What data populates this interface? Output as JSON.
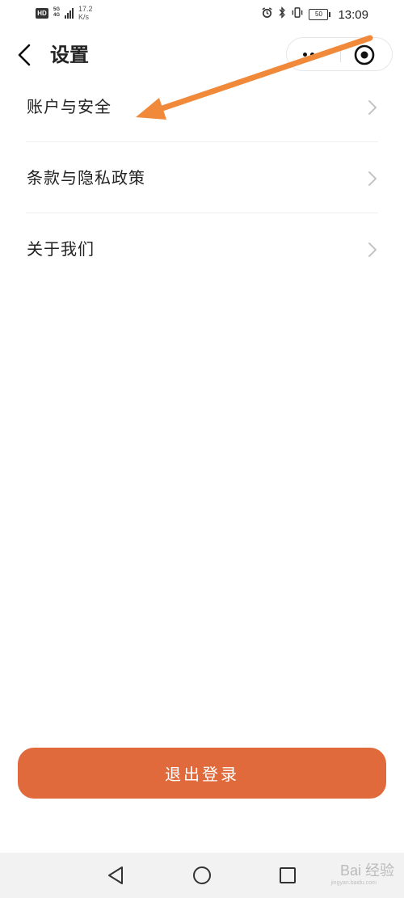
{
  "status_bar": {
    "hd": "HD",
    "network_top": "5G",
    "network_bottom": "4G",
    "speed_value": "17.2",
    "speed_unit": "K/s",
    "battery": "50",
    "time": "13:09"
  },
  "header": {
    "title": "设置",
    "back_icon": "chevron-left-icon",
    "more_icon": "more-dots-icon",
    "close_icon": "target-circle-icon"
  },
  "menu": {
    "items": [
      {
        "label": "账户与安全"
      },
      {
        "label": "条款与隐私政策"
      },
      {
        "label": "关于我们"
      }
    ]
  },
  "logout": {
    "label": "退出登录",
    "color": "#e06a3b"
  },
  "annotation": {
    "arrow_color": "#f08a3a"
  },
  "system_nav": {
    "back_icon": "triangle-back-icon",
    "home_icon": "circle-home-icon",
    "recent_icon": "square-recent-icon"
  },
  "watermark": {
    "text": "Bai 经验",
    "sub": "jingyan.baidu.com"
  }
}
